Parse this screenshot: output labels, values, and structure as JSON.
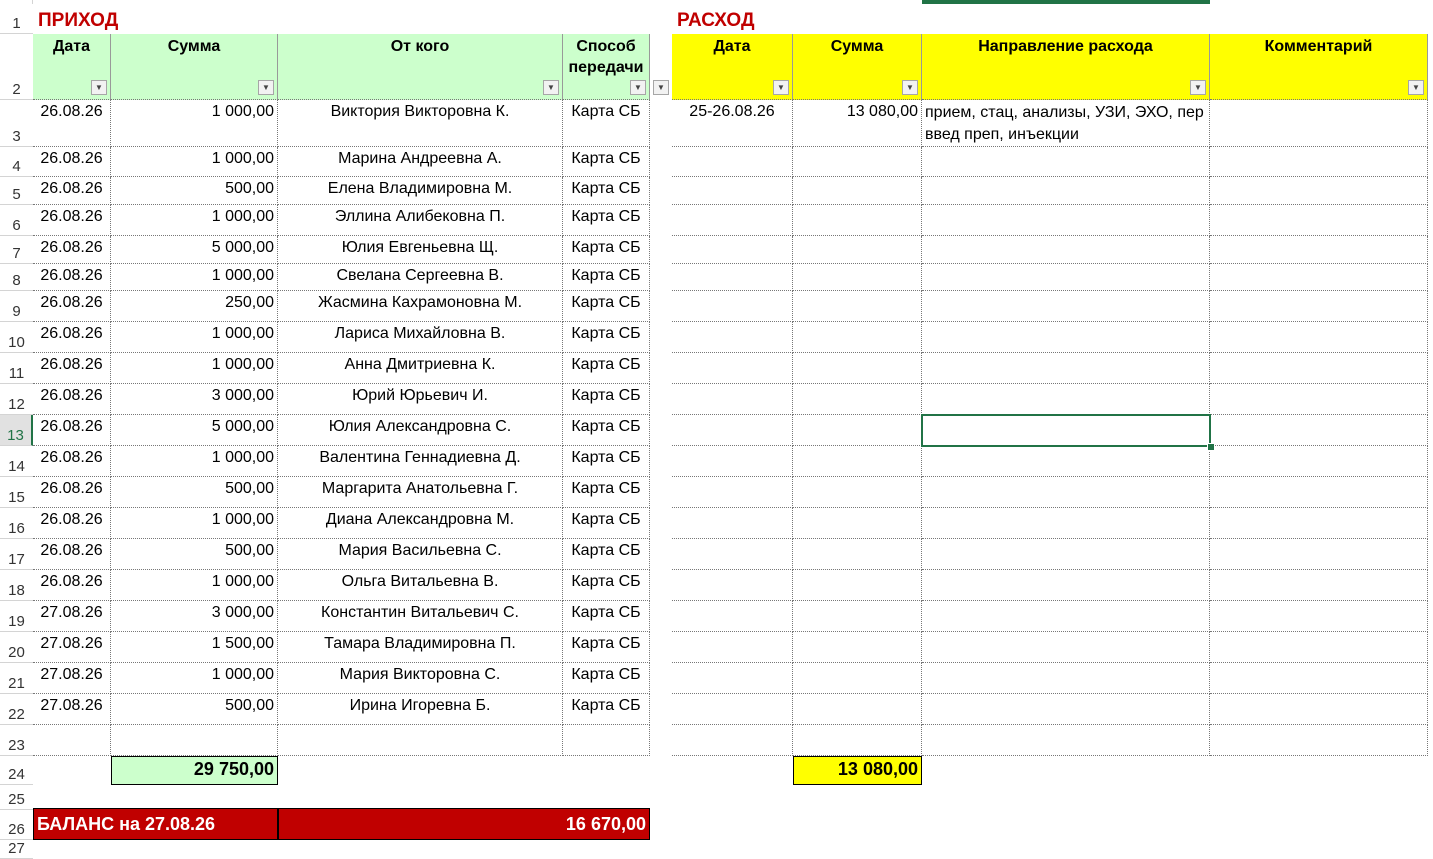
{
  "row_numbers": [
    "1",
    "2",
    "3",
    "4",
    "5",
    "6",
    "7",
    "8",
    "9",
    "10",
    "11",
    "12",
    "13",
    "14",
    "15",
    "16",
    "17",
    "18",
    "19",
    "20",
    "21",
    "22",
    "23",
    "24",
    "25",
    "26",
    "27"
  ],
  "income": {
    "title": "ПРИХОД",
    "headers": [
      "Дата",
      "Сумма",
      "От кого",
      "Способ передачи"
    ],
    "rows": [
      {
        "date": "26.08.26",
        "amount": "1 000,00",
        "from": "Виктория Викторовна К.",
        "method": "Карта СБ"
      },
      {
        "date": "26.08.26",
        "amount": "1 000,00",
        "from": "Марина Андреевна А.",
        "method": "Карта СБ"
      },
      {
        "date": "26.08.26",
        "amount": "500,00",
        "from": "Елена Владимировна М.",
        "method": "Карта СБ"
      },
      {
        "date": "26.08.26",
        "amount": "1 000,00",
        "from": "Эллина Алибековна П.",
        "method": "Карта СБ"
      },
      {
        "date": "26.08.26",
        "amount": "5 000,00",
        "from": "Юлия Евгеньевна Щ.",
        "method": "Карта СБ"
      },
      {
        "date": "26.08.26",
        "amount": "1 000,00",
        "from": "Свелана Сергеевна В.",
        "method": "Карта СБ"
      },
      {
        "date": "26.08.26",
        "amount": "250,00",
        "from": "Жасмина Кахрамоновна М.",
        "method": "Карта СБ"
      },
      {
        "date": "26.08.26",
        "amount": "1 000,00",
        "from": "Лариса Михайловна В.",
        "method": "Карта СБ"
      },
      {
        "date": "26.08.26",
        "amount": "1 000,00",
        "from": "Анна Дмитриевна К.",
        "method": "Карта СБ"
      },
      {
        "date": "26.08.26",
        "amount": "3 000,00",
        "from": "Юрий Юрьевич И.",
        "method": "Карта СБ"
      },
      {
        "date": "26.08.26",
        "amount": "5 000,00",
        "from": "Юлия Александровна С.",
        "method": "Карта СБ"
      },
      {
        "date": "26.08.26",
        "amount": "1 000,00",
        "from": "Валентина Геннадиевна Д.",
        "method": "Карта СБ"
      },
      {
        "date": "26.08.26",
        "amount": "500,00",
        "from": "Маргарита Анатольевна Г.",
        "method": "Карта СБ"
      },
      {
        "date": "26.08.26",
        "amount": "1 000,00",
        "from": "Диана Александровна М.",
        "method": "Карта СБ"
      },
      {
        "date": "26.08.26",
        "amount": "500,00",
        "from": "Мария Васильевна С.",
        "method": "Карта СБ"
      },
      {
        "date": "26.08.26",
        "amount": "1 000,00",
        "from": "Ольга Витальевна В.",
        "method": "Карта СБ"
      },
      {
        "date": "27.08.26",
        "amount": "3 000,00",
        "from": "Константин Витальевич С.",
        "method": "Карта СБ"
      },
      {
        "date": "27.08.26",
        "amount": "1 500,00",
        "from": "Тамара Владимировна П.",
        "method": "Карта СБ"
      },
      {
        "date": "27.08.26",
        "amount": "1 000,00",
        "from": "Мария Викторовна С.",
        "method": "Карта СБ"
      },
      {
        "date": "27.08.26",
        "amount": "500,00",
        "from": "Ирина Игоревна Б.",
        "method": "Карта СБ"
      },
      {
        "date": "",
        "amount": "",
        "from": "",
        "method": ""
      }
    ],
    "total": "29 750,00"
  },
  "expense": {
    "title": "РАСХОД",
    "headers": [
      "Дата",
      "Сумма",
      "Направление расхода",
      "Комментарий"
    ],
    "rows": [
      {
        "date": "25-26.08.26",
        "amount": "13 080,00",
        "direction": "прием, стац, анализы, УЗИ, ЭХО, пер введ преп, инъекции",
        "comment": ""
      }
    ],
    "total": "13 080,00"
  },
  "balance": {
    "label": "БАЛАНС на 27.08.26",
    "value": "16 670,00"
  },
  "filter_glyph": "▼",
  "colors": {
    "income_header": "#ccffcc",
    "expense_header": "#ffff00",
    "title_red": "#c00000",
    "balance_bg": "#c00000",
    "selection": "#217346"
  }
}
